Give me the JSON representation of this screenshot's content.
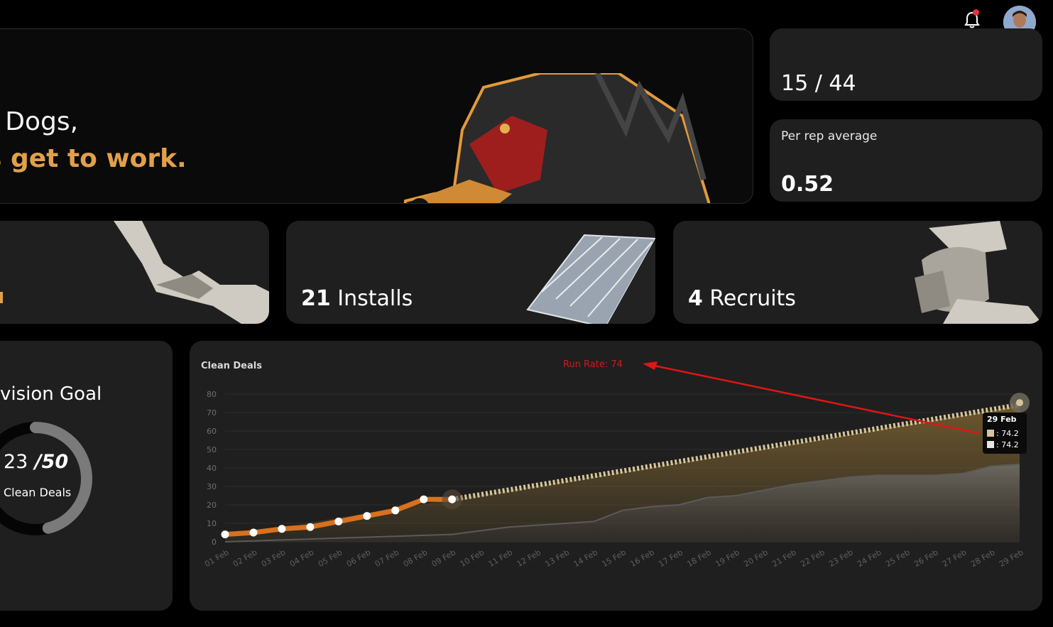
{
  "header": {
    "notification_icon": "bell-icon",
    "avatar": "user-avatar"
  },
  "hero": {
    "line1": "r Dogs,",
    "line2": "s get to work."
  },
  "stats": {
    "top_value": "15 / 44",
    "per_rep_label": "Per rep average",
    "per_rep_value": "0.52"
  },
  "kpis": [
    {
      "value": "",
      "label": ""
    },
    {
      "value": "21",
      "label": " Installs"
    },
    {
      "value": "4",
      "label": " Recruits"
    }
  ],
  "goal": {
    "title": "vision Goal",
    "current": "23",
    "target": " /50",
    "label": "Clean Deals",
    "fraction": 0.46
  },
  "chart_data": {
    "type": "line",
    "title": "Clean Deals",
    "annotation": "Run Rate: 74",
    "categories": [
      "01 Feb",
      "02 Feb",
      "03 Feb",
      "04 Feb",
      "05 Feb",
      "06 Feb",
      "07 Feb",
      "08 Feb",
      "09 Feb",
      "10 Feb",
      "11 Feb",
      "12 Feb",
      "13 Feb",
      "14 Feb",
      "15 Feb",
      "16 Feb",
      "17 Feb",
      "18 Feb",
      "19 Feb",
      "20 Feb",
      "21 Feb",
      "22 Feb",
      "23 Feb",
      "24 Feb",
      "25 Feb",
      "26 Feb",
      "27 Feb",
      "28 Feb",
      "29 Feb"
    ],
    "ylim": [
      0,
      80
    ],
    "yticks": [
      0,
      10,
      20,
      30,
      40,
      50,
      60,
      70,
      80
    ],
    "series": [
      {
        "values": [
          4,
          5,
          7,
          8,
          11,
          14,
          17,
          23,
          23
        ]
      },
      {
        "values": [
          2.5,
          5,
          7.5,
          10.5,
          13,
          15.5,
          18,
          20.5,
          23,
          25.5,
          28,
          30.5,
          33,
          35.5,
          38,
          40.5,
          43,
          45.5,
          48,
          50.5,
          53,
          55.5,
          58,
          61,
          63.5,
          66,
          68.5,
          71,
          74.2
        ]
      },
      {
        "values": [
          0,
          0.5,
          1,
          1.5,
          2,
          2.5,
          3,
          3.5,
          4,
          6,
          8,
          9,
          10,
          11,
          17,
          19,
          20,
          24,
          25,
          28,
          31,
          33,
          35,
          36,
          36,
          36,
          37,
          41,
          42
        ]
      }
    ],
    "colors": {
      "actual": "#d8711f",
      "run_rate": "#d6c59a",
      "fill": "#7a6130"
    },
    "tooltip": {
      "date": "29 Feb",
      "values": [
        ": 74.2",
        ": 74.2"
      ]
    }
  }
}
